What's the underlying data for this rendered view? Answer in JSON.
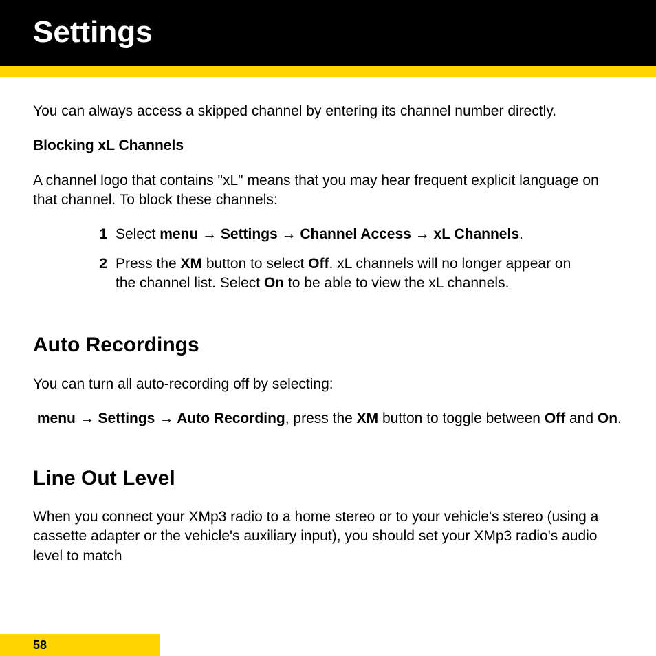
{
  "header": {
    "title": "Settings"
  },
  "intro": "You can always access a skipped channel by entering its channel number directly.",
  "blocking": {
    "heading": "Blocking xL Channels",
    "desc": "A channel logo that contains \"xL\" means that you may hear frequent explicit language on that channel. To block these channels:",
    "steps": [
      {
        "num": "1",
        "pre": "Select ",
        "boldpath": "menu → Settings → Channel Access → xL Channels",
        "post": "."
      },
      {
        "num": "2",
        "t1": "Press the ",
        "b1": "XM",
        "t2": " button to select ",
        "b2": "Off",
        "t3": ".  xL channels will no longer appear on the channel list. Select ",
        "b3": "On",
        "t4": " to be able to view the xL channels."
      }
    ]
  },
  "autorec": {
    "heading": "Auto Recordings",
    "p1": "You can turn all auto-recording off by selecting:",
    "line": {
      "b1": "menu → Settings → Auto Recording",
      "t1": ", press the ",
      "b2": "XM",
      "t2": " button to toggle between ",
      "b3": "Off",
      "t3": " and ",
      "b4": "On",
      "t4": "."
    }
  },
  "lineout": {
    "heading": "Line Out Level",
    "p1": "When you connect your XMp3 radio to a home stereo or to your vehicle's stereo (using a cassette adapter or the vehicle's auxiliary input), you should set your XMp3 radio's audio level to match"
  },
  "footer": {
    "page": "58"
  }
}
